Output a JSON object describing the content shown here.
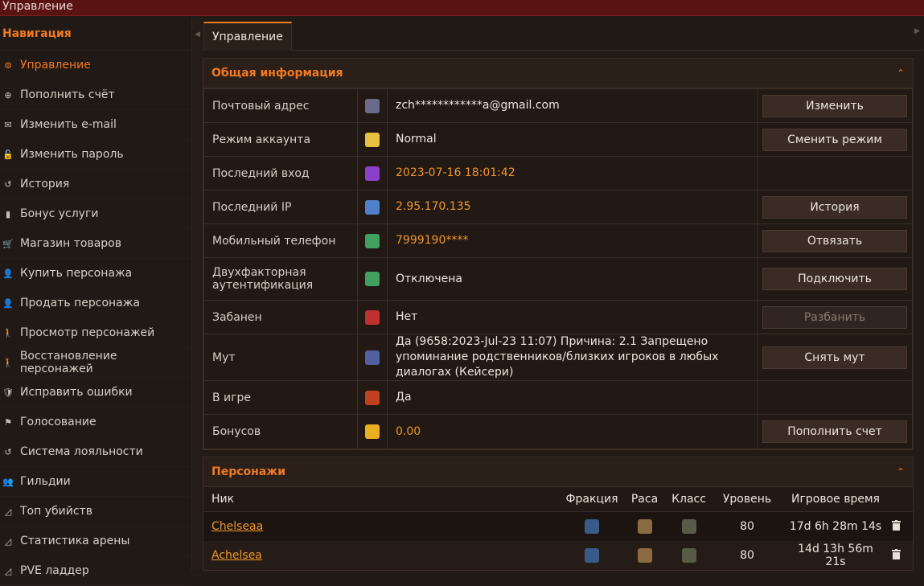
{
  "window": {
    "title": "Управление"
  },
  "sidebar": {
    "header": "Навигация",
    "items": [
      {
        "label": "Управление",
        "icon": "gear-icon",
        "glyph": "⚙",
        "active": true
      },
      {
        "label": "Пополнить счёт",
        "icon": "plus-circle-icon",
        "glyph": "⊕"
      },
      {
        "label": "Изменить e-mail",
        "icon": "envelope-icon",
        "glyph": "✉"
      },
      {
        "label": "Изменить пароль",
        "icon": "lock-icon",
        "glyph": "🔓"
      },
      {
        "label": "История",
        "icon": "history-icon",
        "glyph": "↺"
      },
      {
        "label": "Бонус услуги",
        "icon": "bonus-icon",
        "glyph": "▮"
      },
      {
        "label": "Магазин товаров",
        "icon": "cart-icon",
        "glyph": "🛒"
      },
      {
        "label": "Купить персонажа",
        "icon": "user-icon",
        "glyph": "👤"
      },
      {
        "label": "Продать персонажа",
        "icon": "user-icon",
        "glyph": "👤"
      },
      {
        "label": "Просмотр персонажей",
        "icon": "person-icon",
        "glyph": "🚶"
      },
      {
        "label": "Восстановление персонажей",
        "icon": "person-icon",
        "glyph": "🚶"
      },
      {
        "label": "Исправить ошибки",
        "icon": "shield-icon",
        "glyph": "🛡"
      },
      {
        "label": "Голосование",
        "icon": "flag-icon",
        "glyph": "⚑"
      },
      {
        "label": "Система лояльности",
        "icon": "history-icon",
        "glyph": "↺"
      },
      {
        "label": "Гильдии",
        "icon": "users-icon",
        "glyph": "👥"
      },
      {
        "label": "Топ убийств",
        "icon": "area-chart-icon",
        "glyph": "◿"
      },
      {
        "label": "Статистика арены",
        "icon": "area-chart-icon",
        "glyph": "◿"
      },
      {
        "label": "PVE ладдер",
        "icon": "area-chart-icon",
        "glyph": "◿"
      }
    ]
  },
  "tabs": [
    {
      "label": "Управление"
    }
  ],
  "general": {
    "title": "Общая информация",
    "rows": [
      {
        "label": "Почтовый адрес",
        "icon": "email-rune-icon",
        "icon_color": "#6a6a8a",
        "value": "zch************a@gmail.com",
        "orange": false,
        "button": "Изменить"
      },
      {
        "label": "Режим аккаунта",
        "icon": "star-icon",
        "icon_color": "#e8c040",
        "value": "Normal",
        "orange": false,
        "button": "Сменить режим"
      },
      {
        "label": "Последний вход",
        "icon": "login-orb-icon",
        "icon_color": "#8a40c8",
        "value": "2023-07-16 18:01:42",
        "orange": true,
        "button": ""
      },
      {
        "label": "Последний IP",
        "icon": "network-icon",
        "icon_color": "#5080c8",
        "value": "2.95.170.135",
        "orange": true,
        "button": "История"
      },
      {
        "label": "Мобильный телефон",
        "icon": "phone-icon",
        "icon_color": "#40a060",
        "value": "7999190****",
        "orange": true,
        "button": "Отвязать"
      },
      {
        "label": "Двухфакторная аутентификация",
        "icon": "phone-icon",
        "icon_color": "#40a060",
        "value": "Отключена",
        "orange": false,
        "button": "Подключить"
      },
      {
        "label": "Забанен",
        "icon": "ban-hand-icon",
        "icon_color": "#c03030",
        "value": "Нет",
        "orange": false,
        "button": "Разбанить",
        "disabled": true
      },
      {
        "label": "Мут",
        "icon": "mute-scroll-icon",
        "icon_color": "#5060a0",
        "value": "Да (9658:2023-Jul-23 11:07) Причина: 2.1 Запрещено упоминание родственников/близких игроков в любых диалогах (Кейсери)",
        "orange": false,
        "button": "Снять мут"
      },
      {
        "label": "В игре",
        "icon": "ingame-icon",
        "icon_color": "#c04020",
        "value": "Да",
        "orange": false,
        "button": ""
      },
      {
        "label": "Бонусов",
        "icon": "coin-icon",
        "icon_color": "#e8b020",
        "value": "0.00",
        "orange": true,
        "button": "Пополнить счет"
      }
    ]
  },
  "characters": {
    "title": "Персонажи",
    "headers": {
      "nick": "Ник",
      "faction": "Фракция",
      "race": "Раса",
      "class": "Класс",
      "level": "Уровень",
      "time": "Игровое время"
    },
    "rows": [
      {
        "nick": "Chelseaa",
        "faction_icon": "alliance-icon",
        "race_icon": "race-icon",
        "class_icon": "class-icon",
        "level": "80",
        "time": "17d 6h 28m 14s"
      },
      {
        "nick": "Achelsea",
        "faction_icon": "alliance-icon",
        "race_icon": "race-icon",
        "class_icon": "class-icon",
        "level": "80",
        "time": "14d 13h 56m 21s"
      }
    ]
  }
}
